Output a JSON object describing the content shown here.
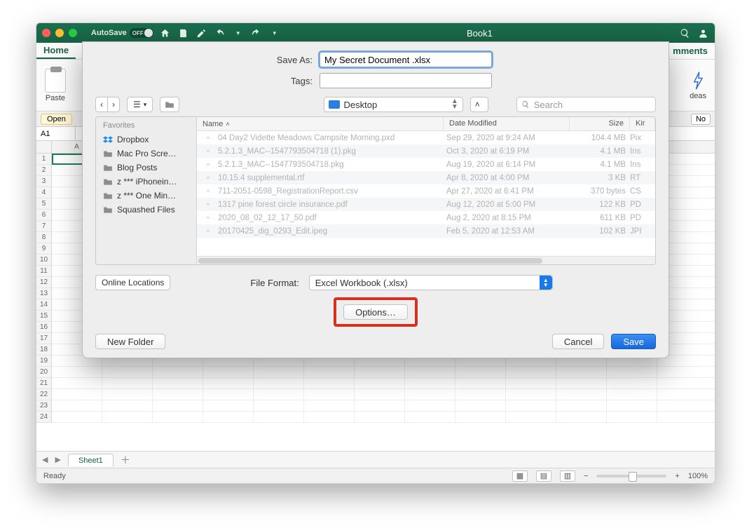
{
  "titlebar": {
    "autosave_label": "AutoSave",
    "autosave_off": "OFF",
    "doc_title": "Book1"
  },
  "ribbon": {
    "tabs": {
      "home": "Home",
      "comments": "mments"
    },
    "paste_label": "Paste",
    "ideas_label": "deas"
  },
  "name_row": {
    "open_label": "Open",
    "no_label": "No"
  },
  "cell_ref": "A1",
  "columns_letter_a": "A",
  "sheet_tabs": {
    "sheet1": "Sheet1"
  },
  "status": {
    "ready": "Ready",
    "zoom": "100%"
  },
  "dialog": {
    "save_as_label": "Save As:",
    "save_as_value": "My Secret Document .xlsx",
    "tags_label": "Tags:",
    "location_name": "Desktop",
    "search_placeholder": "Search",
    "sidebar": {
      "section": "Favorites",
      "items": [
        "Dropbox",
        "Mac Pro Scre…",
        "Blog Posts",
        "z *** iPhonein…",
        "z *** One Min…",
        "Squashed Files"
      ]
    },
    "columns": {
      "name": "Name",
      "date": "Date Modified",
      "size": "Size",
      "kind": "Kir"
    },
    "files": [
      {
        "name": "04 Day2 Vidette Meadows Campsite Morning.pxd",
        "date": "Sep 29, 2020 at 9:24 AM",
        "size": "104.4 MB",
        "kind": "Pix"
      },
      {
        "name": "5.2.1.3_MAC--1547793504718 (1).pkg",
        "date": "Oct 3, 2020 at 6:19 PM",
        "size": "4.1 MB",
        "kind": "Ins"
      },
      {
        "name": "5.2.1.3_MAC--1547793504718.pkg",
        "date": "Aug 19, 2020 at 6:14 PM",
        "size": "4.1 MB",
        "kind": "Ins"
      },
      {
        "name": "10.15.4 supplemental.rtf",
        "date": "Apr 8, 2020 at 4:00 PM",
        "size": "3 KB",
        "kind": "RT"
      },
      {
        "name": "711-2051-0598_RegistrationReport.csv",
        "date": "Apr 27, 2020 at 6:41 PM",
        "size": "370 bytes",
        "kind": "CS"
      },
      {
        "name": "1317 pine forest circle insurance.pdf",
        "date": "Aug 12, 2020 at 5:00 PM",
        "size": "122 KB",
        "kind": "PD"
      },
      {
        "name": "2020_08_02_12_17_50.pdf",
        "date": "Aug 2, 2020 at 8:15 PM",
        "size": "611 KB",
        "kind": "PD"
      },
      {
        "name": "20170425_dig_0293_Edit.ipeg",
        "date": "Feb 5, 2020 at 12:53 AM",
        "size": "102 KB",
        "kind": "JPI"
      }
    ],
    "online_locations": "Online Locations",
    "file_format_label": "File Format:",
    "file_format_value": "Excel Workbook (.xlsx)",
    "options_label": "Options…",
    "new_folder": "New Folder",
    "cancel": "Cancel",
    "save": "Save"
  }
}
